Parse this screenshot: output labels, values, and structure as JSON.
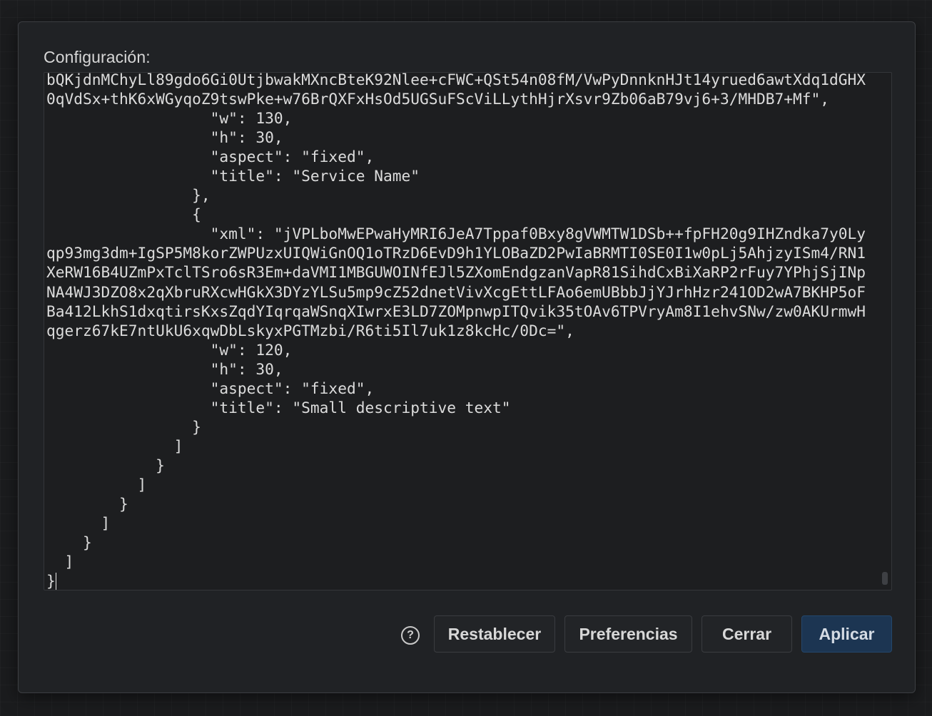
{
  "dialog": {
    "label": "Configuración:",
    "editor_text": "bQKjdnMChyLl89gdo6Gi0UtjbwakMXncBteK92Nlee+cFWC+QSt54n08fM/VwPyDnnknHJt14yrued6awtXdq1dGHX\n0qVdSx+thK6xWGyqoZ9tswPke+w76BrQXFxHsOd5UGSuFScViLLythHjrXsvr9Zb06aB79vj6+3/MHDB7+Mf\",\n                  \"w\": 130,\n                  \"h\": 30,\n                  \"aspect\": \"fixed\",\n                  \"title\": \"Service Name\"\n                },\n                {\n                  \"xml\": \"jVPLboMwEPwaHyMRI6JeA7Tppaf0Bxy8gVWMTW1DSb++fpFH20g9IHZndka7y0Ly\nqp93mg3dm+IgSP5M8korZWPUzxUIQWiGnOQ1oTRzD6EvD9h1YLOBaZD2PwIaBRMTI0SE0I1w0pLj5AhjzyISm4/RN1\nXeRW16B4UZmPxTclTSro6sR3Em+daVMI1MBGUWOINfEJl5ZXomEndgzanVapR81SihdCxBiXaRP2rFuy7YPhjSjINp\nNA4WJ3DZO8x2qXbruRXcwHGkX3DYzYLSu5mp9cZ52dnetVivXcgEttLFAo6emUBbbJjYJrhHzr241OD2wA7BKHP5oF\nBa412LkhS1dxqtirsKxsZqdYIqrqaWSnqXIwrxE3LD7ZOMpnwpITQvik35tOAv6TPVryAm8I1ehvSNw/zw0AKUrmwH\nqgerz67kE7ntUkU6xqwDbLskyxPGTMzbi/R6ti5Il7uk1z8kcHc/0Dc=\",\n                  \"w\": 120,\n                  \"h\": 30,\n                  \"aspect\": \"fixed\",\n                  \"title\": \"Small descriptive text\"\n                }\n              ]\n            }\n          ]\n        }\n      ]\n    }\n  ]\n}"
  },
  "buttons": {
    "help_icon": "help-circle-icon",
    "help_glyph": "?",
    "reset_label": "Restablecer",
    "preferences_label": "Preferencias",
    "close_label": "Cerrar",
    "apply_label": "Aplicar"
  },
  "colors": {
    "background": "#1b1c1e",
    "dialog": "#202225",
    "primary_button": "#1c3552",
    "text": "#dcdcdc"
  }
}
